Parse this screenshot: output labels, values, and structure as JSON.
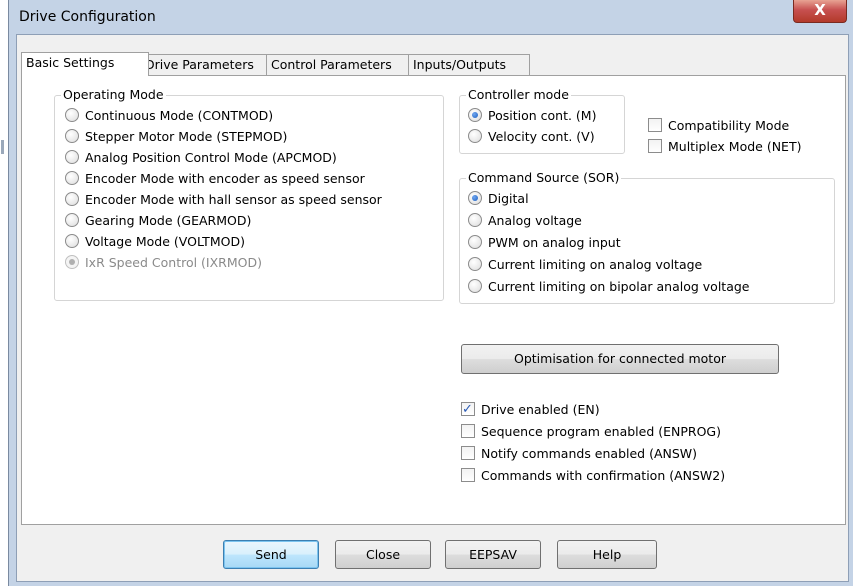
{
  "window": {
    "title": "Drive Configuration",
    "close_glyph": "X"
  },
  "tabs": [
    {
      "label": "Basic Settings",
      "active": true
    },
    {
      "label": "Drive Parameters",
      "active": false
    },
    {
      "label": "Control Parameters",
      "active": false
    },
    {
      "label": "Inputs/Outputs",
      "active": false
    }
  ],
  "operating_mode": {
    "legend": "Operating Mode",
    "options": [
      {
        "label": "Continuous Mode (CONTMOD)",
        "checked": false,
        "enabled": true
      },
      {
        "label": "Stepper Motor Mode (STEPMOD)",
        "checked": false,
        "enabled": true
      },
      {
        "label": "Analog Position Control Mode (APCMOD)",
        "checked": false,
        "enabled": true
      },
      {
        "label": "Encoder Mode with encoder as speed sensor",
        "checked": false,
        "enabled": true
      },
      {
        "label": "Encoder Mode with hall sensor as speed sensor",
        "checked": false,
        "enabled": true
      },
      {
        "label": "Gearing Mode (GEARMOD)",
        "checked": false,
        "enabled": true
      },
      {
        "label": "Voltage Mode (VOLTMOD)",
        "checked": false,
        "enabled": true
      },
      {
        "label": "IxR Speed Control (IXRMOD)",
        "checked": true,
        "enabled": false
      }
    ]
  },
  "controller_mode": {
    "legend": "Controller mode",
    "options": [
      {
        "label": "Position cont. (M)",
        "checked": true
      },
      {
        "label": "Velocity cont. (V)",
        "checked": false
      }
    ]
  },
  "compatibility_mode": {
    "label": "Compatibility Mode",
    "checked": false
  },
  "multiplex_mode": {
    "label": "Multiplex Mode (NET)",
    "checked": false
  },
  "command_source": {
    "legend": "Command Source (SOR)",
    "options": [
      {
        "label": "Digital",
        "checked": true
      },
      {
        "label": "Analog voltage",
        "checked": false
      },
      {
        "label": "PWM on analog input",
        "checked": false
      },
      {
        "label": "Current limiting on analog voltage",
        "checked": false
      },
      {
        "label": "Current limiting on bipolar analog voltage",
        "checked": false
      }
    ]
  },
  "optimisation_button": "Optimisation for connected motor",
  "flags": [
    {
      "label": "Drive enabled (EN)",
      "checked": true
    },
    {
      "label": "Sequence program enabled (ENPROG)",
      "checked": false
    },
    {
      "label": "Notify commands enabled (ANSW)",
      "checked": false
    },
    {
      "label": "Commands with confirmation (ANSW2)",
      "checked": false
    }
  ],
  "footer_buttons": {
    "send": "Send",
    "close": "Close",
    "eepsav": "EEPSAV",
    "help": "Help"
  },
  "colors": {
    "frame": "#c4d3e6",
    "close_button": "#c75050",
    "radio_dot": "#1c5fc0",
    "check_mark": "#2a5ab5"
  }
}
